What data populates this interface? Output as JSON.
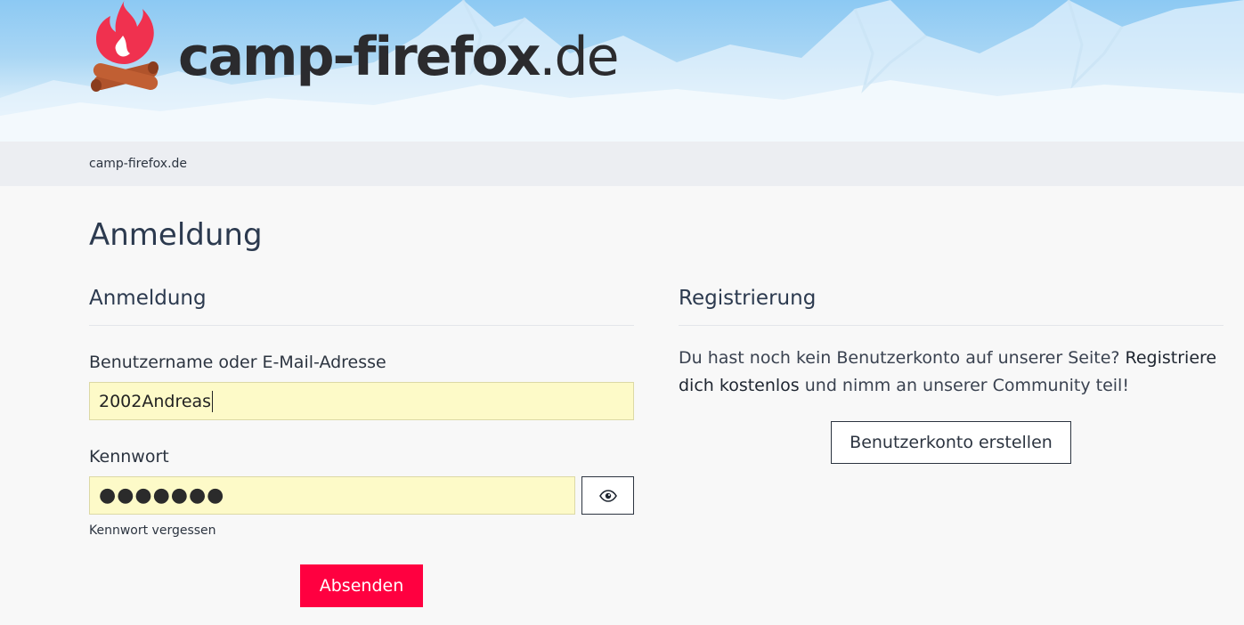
{
  "header": {
    "brand_bold": "camp-firefox",
    "brand_light": ".de",
    "logo_icon": "campfire-logo-icon",
    "colors": {
      "flame": "#f0314f",
      "logs": "#b0532b",
      "brand_text": "#2b2b2e",
      "sky": "#8cc9f3"
    }
  },
  "breadcrumb": {
    "home_label": "camp-firefox.de"
  },
  "page": {
    "title": "Anmeldung"
  },
  "login": {
    "section_title": "Anmeldung",
    "username_label": "Benutzername oder E-Mail-Adresse",
    "username_value": "2002Andreas",
    "password_label": "Kennwort",
    "password_masked": "●●●●●●●",
    "show_password_icon": "eye-icon",
    "forgot_label": "Kennwort vergessen",
    "submit_label": "Absenden",
    "colors": {
      "autofill_bg": "#fdfac8",
      "submit_bg": "#ff0040"
    }
  },
  "register": {
    "section_title": "Registrierung",
    "text_before": "Du hast noch kein Benutzerkonto auf unserer Seite? ",
    "link_label": "Registriere dich kostenlos",
    "text_after": " und nimm an unserer Community teil!",
    "create_button_label": "Benutzerkonto erstellen"
  }
}
